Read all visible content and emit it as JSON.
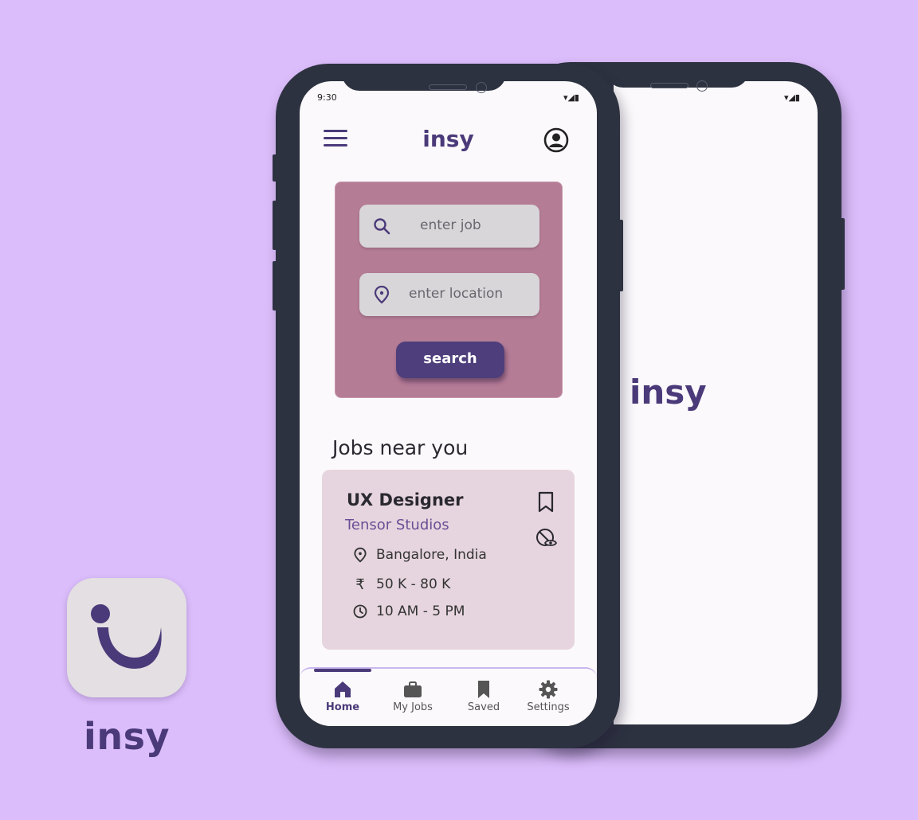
{
  "brand": {
    "name": "insy"
  },
  "status_bar": {
    "time": "9:30",
    "icons": "▾◢▮"
  },
  "header": {
    "title": "insy",
    "menu_icon": "hamburger-icon",
    "profile_icon": "profile-icon"
  },
  "search": {
    "job_placeholder": "enter job",
    "location_placeholder": "enter location",
    "button_label": "search"
  },
  "jobs_section": {
    "title": "Jobs near you",
    "jobs": [
      {
        "title": "UX Designer",
        "company": "Tensor Studios",
        "location": "Bangalore, India",
        "salary": "50 K - 80 K",
        "currency_symbol": "₹",
        "hours": "10 AM - 5 PM"
      }
    ]
  },
  "bottom_nav": {
    "items": [
      {
        "label": "Home",
        "icon": "home-icon",
        "active": true
      },
      {
        "label": "My Jobs",
        "icon": "briefcase-icon",
        "active": false
      },
      {
        "label": "Saved",
        "icon": "bookmark-icon",
        "active": false
      },
      {
        "label": "Settings",
        "icon": "gear-icon",
        "active": false
      }
    ]
  },
  "splash": {
    "title": "insy"
  },
  "colors": {
    "background": "#dcbdfb",
    "primary": "#4b3a7a",
    "search_card": "#b57c96",
    "job_card": "#e6d5de",
    "phone_frame": "#2d3240"
  }
}
